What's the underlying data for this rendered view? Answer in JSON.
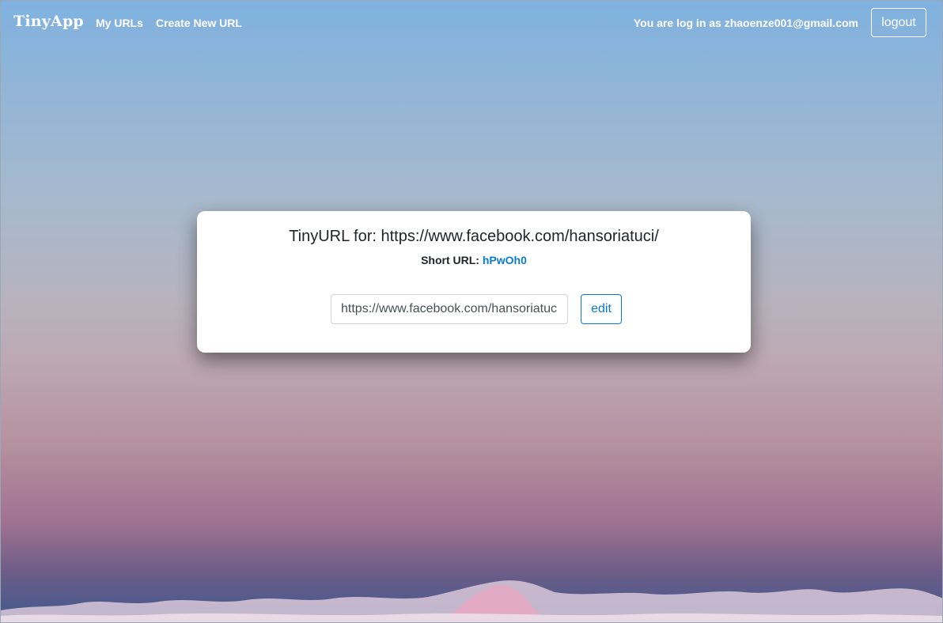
{
  "navbar": {
    "brand": "TinyApp",
    "links": [
      {
        "label": "My URLs"
      },
      {
        "label": "Create New URL"
      }
    ],
    "login_text": "You are log in as zhaoenze001@gmail.com",
    "logout_label": "logout"
  },
  "card": {
    "title": "TinyURL for: https://www.facebook.com/hansoriatuci/",
    "short_url_label": "Short URL:",
    "short_url_value": "hPwOh0",
    "input_value": "https://www.facebook.com/hansoriatuci/",
    "edit_label": "edit"
  },
  "colors": {
    "accent": "#0b7ad1",
    "text": "#212529",
    "nav_text": "#ffffff"
  }
}
